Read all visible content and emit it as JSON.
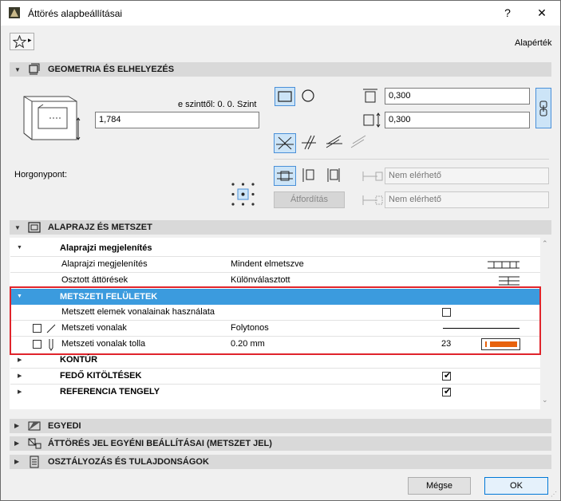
{
  "window": {
    "title": "Áttörés alapbeállításai",
    "help": "?",
    "close": "✕"
  },
  "toolbar": {
    "favorite_menu_arrow": "▸",
    "default_label": "Alapérték"
  },
  "geometry": {
    "header": "GEOMETRIA ÉS ELHELYEZÉS",
    "level_label": "e szinttől: 0. 0. Szint",
    "elevation_value": "1,784",
    "anchor_label": "Horgonypont:",
    "width_value": "0,300",
    "height_value": "0,300",
    "unavailable_1": "Nem elérhető",
    "unavailable_2": "Nem elérhető",
    "flip_button": "Átfordítás"
  },
  "floorplan": {
    "header": "ALAPRAJZ ÉS METSZET",
    "groups": [
      {
        "label": "Alaprajzi megjelenítés",
        "rows": [
          {
            "name": "Alaprajzi megjelenítés",
            "value": "Mindent elmetszve"
          },
          {
            "name": "Osztott áttörések",
            "value": "Különválasztott"
          }
        ]
      },
      {
        "label": "METSZETI FELÜLETEK",
        "rows": [
          {
            "name": "Metszett elemek vonalainak használata",
            "value": ""
          },
          {
            "name": "Metszeti vonalak",
            "value": "Folytonos"
          },
          {
            "name": "Metszeti vonalak tolla",
            "value": "0.20 mm",
            "pen": "23"
          }
        ]
      },
      {
        "label": "KONTÚR"
      },
      {
        "label": "FEDŐ KITÖLTÉSEK"
      },
      {
        "label": "REFERENCIA TENGELY"
      }
    ],
    "pen_color": "#e8620c",
    "highlight_color": "#e0242b",
    "selected_bg": "#3b9bde"
  },
  "sections": {
    "custom": "EGYEDI",
    "marker": "ÁTTÖRÉS JEL EGYÉNI BEÁLLÍTÁSAI (METSZET JEL)",
    "classification": "OSZTÁLYOZÁS ÉS TULAJDONSÁGOK"
  },
  "footer": {
    "cancel": "Mégse",
    "ok": "OK"
  }
}
